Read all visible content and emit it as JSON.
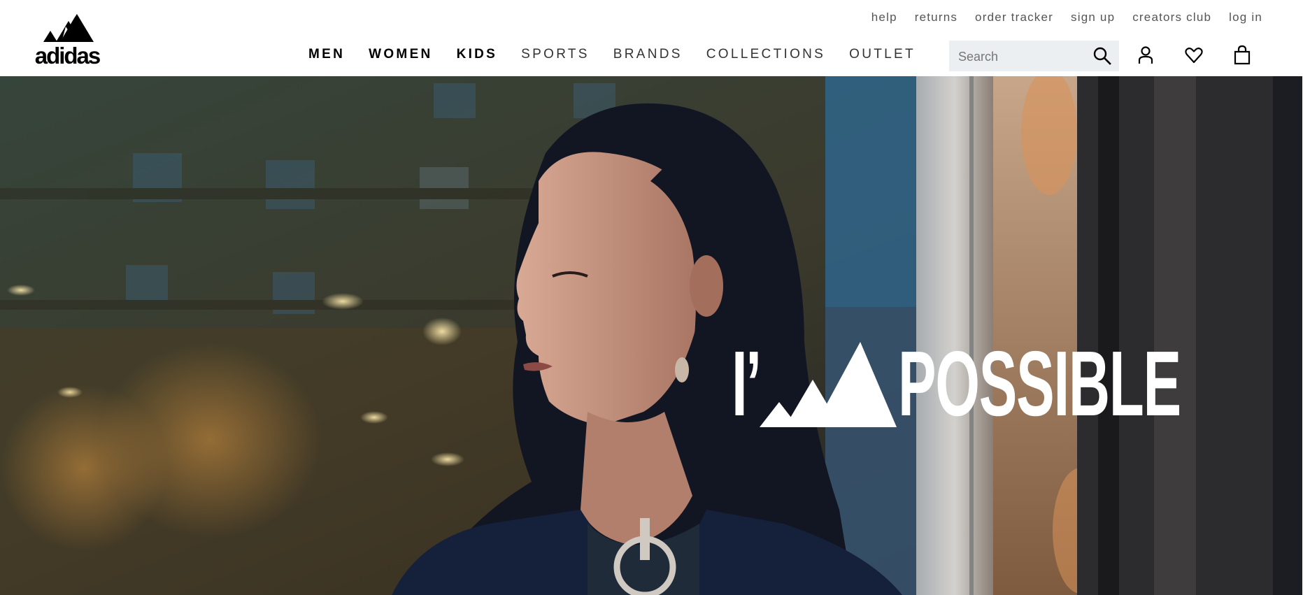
{
  "brand": {
    "logo_text": "adidas"
  },
  "utility_nav": [
    "help",
    "returns",
    "order tracker",
    "sign up",
    "creators club",
    "log in"
  ],
  "main_nav": [
    {
      "label": "MEN",
      "bold": true
    },
    {
      "label": "WOMEN",
      "bold": true
    },
    {
      "label": "KIDS",
      "bold": true
    },
    {
      "label": "SPORTS",
      "bold": false
    },
    {
      "label": "BRANDS",
      "bold": false
    },
    {
      "label": "COLLECTIONS",
      "bold": false
    },
    {
      "label": "OUTLET",
      "bold": false
    }
  ],
  "search": {
    "placeholder": "Search",
    "value": "",
    "icon": "search-icon"
  },
  "header_icons": [
    "account-icon",
    "wishlist-heart-icon",
    "shopping-bag-icon"
  ],
  "hero": {
    "tagline_prefix": "I’",
    "tagline_suffix": "POSSIBLE",
    "tagline_color": "#ffffff"
  },
  "colors": {
    "header_bg": "#ffffff",
    "search_bg": "#eceff1",
    "text": "#000000"
  }
}
